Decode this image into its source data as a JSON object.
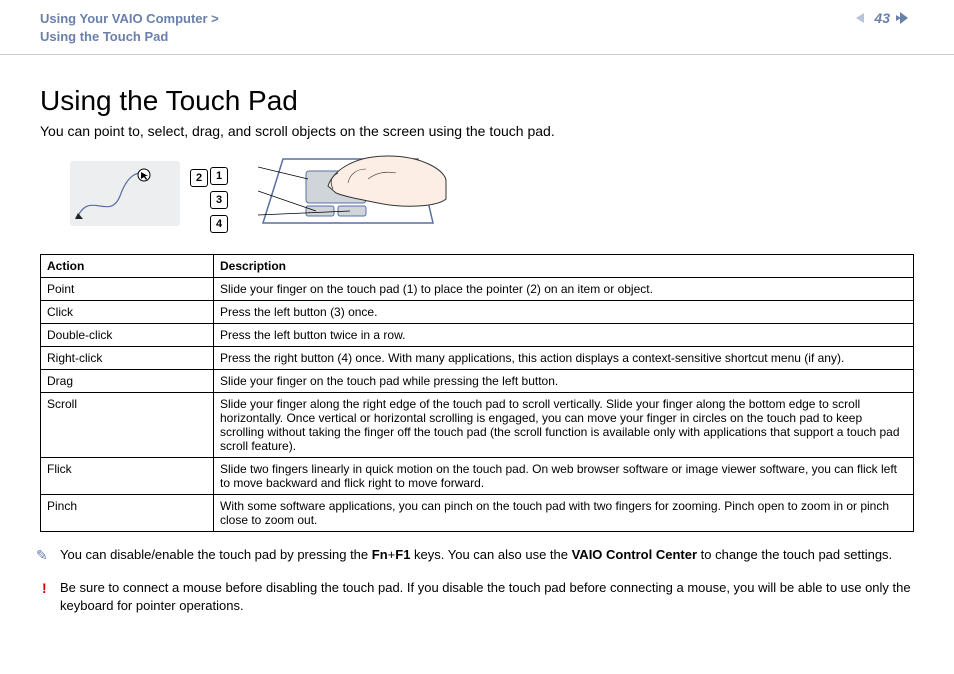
{
  "header": {
    "breadcrumb_line1": "Using Your VAIO Computer >",
    "breadcrumb_line2": "Using the Touch Pad",
    "page_number": "43"
  },
  "page": {
    "title": "Using the Touch Pad",
    "intro": "You can point to, select, drag, and scroll objects on the screen using the touch pad."
  },
  "callouts": {
    "c1": "1",
    "c2": "2",
    "c3": "3",
    "c4": "4"
  },
  "table": {
    "header_action": "Action",
    "header_description": "Description",
    "rows": [
      {
        "action": "Point",
        "desc": "Slide your finger on the touch pad (1) to place the pointer (2) on an item or object."
      },
      {
        "action": "Click",
        "desc": "Press the left button (3) once."
      },
      {
        "action": "Double-click",
        "desc": "Press the left button twice in a row."
      },
      {
        "action": "Right-click",
        "desc": "Press the right button (4) once. With many applications, this action displays a context-sensitive shortcut menu (if any)."
      },
      {
        "action": "Drag",
        "desc": "Slide your finger on the touch pad while pressing the left button."
      },
      {
        "action": "Scroll",
        "desc": "Slide your finger along the right edge of the touch pad to scroll vertically. Slide your finger along the bottom edge to scroll horizontally. Once vertical or horizontal scrolling is engaged, you can move your finger in circles on the touch pad to keep scrolling without taking the finger off the touch pad (the scroll function is available only with applications that support a touch pad scroll feature)."
      },
      {
        "action": "Flick",
        "desc": "Slide two fingers linearly in quick motion on the touch pad. On web browser software or image viewer software, you can flick left to move backward and flick right to move forward."
      },
      {
        "action": "Pinch",
        "desc": "With some software applications, you can pinch on the touch pad with two fingers for zooming. Pinch open to zoom in or pinch close to zoom out."
      }
    ]
  },
  "notes": {
    "tip_prefix": "You can disable/enable the touch pad by pressing the ",
    "tip_bold1": "Fn",
    "tip_plus": "+",
    "tip_bold2": "F1",
    "tip_mid": " keys. You can also use the ",
    "tip_bold3": "VAIO Control Center",
    "tip_suffix": " to change the touch pad settings.",
    "warning": "Be sure to connect a mouse before disabling the touch pad. If you disable the touch pad before connecting a mouse, you will be able to use only the keyboard for pointer operations."
  }
}
